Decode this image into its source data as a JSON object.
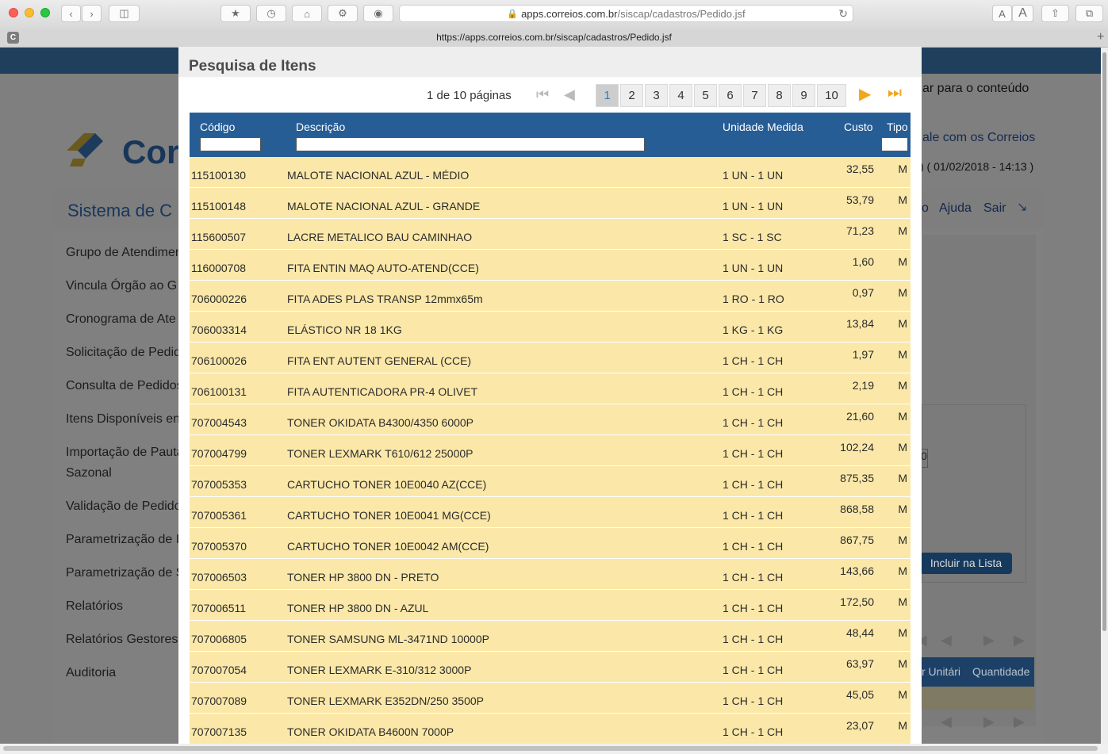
{
  "browser": {
    "url_display_domain": "apps.correios.com.br",
    "url_display_path": "/siscap/cadastros/Pedido.jsf",
    "tab_url": "https://apps.correios.com.br/siscap/cadastros/Pedido.jsf",
    "tab_favicon_letter": "C",
    "font_small": "A",
    "font_large": "A"
  },
  "background_page": {
    "logo_text": "Cor",
    "system_title": "Sistema de C",
    "skip_link": "ar para o conteúdo",
    "contact_link": "ale com os Correios",
    "datetime": ") ( 01/02/2018 - 14:13 )",
    "nav_links": {
      "partial": "o",
      "help": "Ajuda",
      "logout": "Sair"
    },
    "menu": [
      "Grupo de Atendimen",
      "Vincula Órgão ao G",
      "Cronograma de Ate",
      "Solicitação de Pedid",
      "Consulta de Pedidos",
      "Itens Disponíveis en",
      "Importação de Pauta",
      "Sazonal",
      "Validação de Pedido",
      "Parametrização de I",
      "Parametrização de S",
      "Relatórios",
      "Relatórios Gestores",
      "Auditoria"
    ],
    "include_button": "Incluir na Lista",
    "bottom_headers": {
      "unit_price": "r Unitári",
      "quantity": "Quantidade"
    },
    "field_fragment": "0"
  },
  "modal": {
    "title": "Pesquisa de Itens",
    "page_info": "1 de 10 páginas",
    "pages": [
      "1",
      "2",
      "3",
      "4",
      "5",
      "6",
      "7",
      "8",
      "9",
      "10"
    ],
    "columns": {
      "code": "Código",
      "description": "Descrição",
      "unit": "Unidade Medida",
      "cost": "Custo",
      "type": "Tipo"
    },
    "rows": [
      {
        "code": "115100130",
        "description": "MALOTE NACIONAL AZUL - MÉDIO",
        "unit": "1 UN - 1 UN",
        "cost": "32,55",
        "type": "M"
      },
      {
        "code": "115100148",
        "description": "MALOTE NACIONAL AZUL - GRANDE",
        "unit": "1 UN - 1 UN",
        "cost": "53,79",
        "type": "M"
      },
      {
        "code": "115600507",
        "description": "LACRE METALICO BAU CAMINHAO",
        "unit": "1 SC - 1 SC",
        "cost": "71,23",
        "type": "M"
      },
      {
        "code": "116000708",
        "description": "FITA ENTIN MAQ AUTO-ATEND(CCE)",
        "unit": "1 UN - 1 UN",
        "cost": "1,60",
        "type": "M"
      },
      {
        "code": "706000226",
        "description": "FITA ADES PLAS TRANSP 12mmx65m",
        "unit": "1 RO - 1 RO",
        "cost": "0,97",
        "type": "M"
      },
      {
        "code": "706003314",
        "description": "ELÁSTICO NR 18 1KG",
        "unit": "1 KG - 1 KG",
        "cost": "13,84",
        "type": "M"
      },
      {
        "code": "706100026",
        "description": "FITA ENT AUTENT GENERAL (CCE)",
        "unit": "1 CH - 1 CH",
        "cost": "1,97",
        "type": "M"
      },
      {
        "code": "706100131",
        "description": "FITA AUTENTICADORA PR-4 OLIVET",
        "unit": "1 CH - 1 CH",
        "cost": "2,19",
        "type": "M"
      },
      {
        "code": "707004543",
        "description": "TONER OKIDATA B4300/4350 6000P",
        "unit": "1 CH - 1 CH",
        "cost": "21,60",
        "type": "M"
      },
      {
        "code": "707004799",
        "description": "TONER LEXMARK T610/612 25000P",
        "unit": "1 CH - 1 CH",
        "cost": "102,24",
        "type": "M"
      },
      {
        "code": "707005353",
        "description": "CARTUCHO TONER 10E0040 AZ(CCE)",
        "unit": "1 CH - 1 CH",
        "cost": "875,35",
        "type": "M"
      },
      {
        "code": "707005361",
        "description": "CARTUCHO TONER 10E0041 MG(CCE)",
        "unit": "1 CH - 1 CH",
        "cost": "868,58",
        "type": "M"
      },
      {
        "code": "707005370",
        "description": "CARTUCHO TONER 10E0042 AM(CCE)",
        "unit": "1 CH - 1 CH",
        "cost": "867,75",
        "type": "M"
      },
      {
        "code": "707006503",
        "description": "TONER HP 3800 DN - PRETO",
        "unit": "1 CH - 1 CH",
        "cost": "143,66",
        "type": "M"
      },
      {
        "code": "707006511",
        "description": "TONER HP 3800 DN - AZUL",
        "unit": "1 CH - 1 CH",
        "cost": "172,50",
        "type": "M"
      },
      {
        "code": "707006805",
        "description": "TONER SAMSUNG ML-3471ND 10000P",
        "unit": "1 CH - 1 CH",
        "cost": "48,44",
        "type": "M"
      },
      {
        "code": "707007054",
        "description": "TONER LEXMARK E-310/312 3000P",
        "unit": "1 CH - 1 CH",
        "cost": "63,97",
        "type": "M"
      },
      {
        "code": "707007089",
        "description": "TONER LEXMARK E352DN/250 3500P",
        "unit": "1 CH - 1 CH",
        "cost": "45,05",
        "type": "M"
      },
      {
        "code": "707007135",
        "description": "TONER OKIDATA B4600N 7000P",
        "unit": "1 CH - 1 CH",
        "cost": "23,07",
        "type": "M"
      }
    ]
  },
  "colors": {
    "table_header": "#265d95",
    "row_background": "#fbe8a9",
    "pager_accent": "#f2a71b",
    "active_page_text": "#2a7fc1"
  },
  "icons": [
    "back-icon",
    "forward-icon",
    "sidebar-icon",
    "bookmarks-icon",
    "history-icon",
    "home-icon",
    "settings-icon",
    "record-icon",
    "lock-icon",
    "reload-icon",
    "share-icon",
    "tabs-icon",
    "new-tab-icon",
    "first-page-icon",
    "prev-page-icon",
    "next-page-icon",
    "last-page-icon"
  ]
}
